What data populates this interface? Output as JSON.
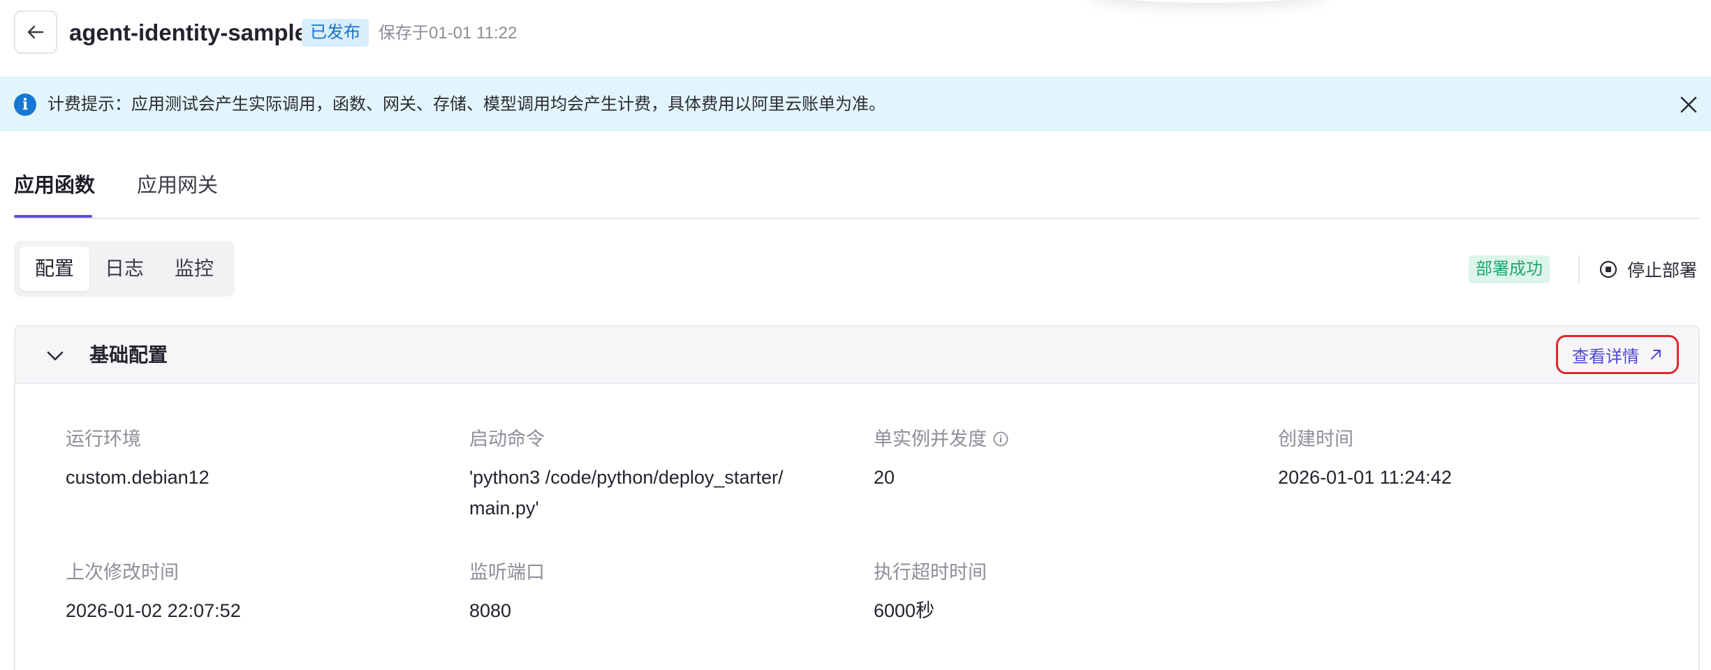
{
  "header": {
    "app_name": "agent-identity-sample",
    "status": "已发布",
    "saved_at": "保存于01-01 11:22"
  },
  "notice": {
    "text": "计费提示：应用测试会产生实际调用，函数、网关、存储、模型调用均会产生计费，具体费用以阿里云账单为准。"
  },
  "main_tabs": [
    {
      "label": "应用函数",
      "active": true
    },
    {
      "label": "应用网关",
      "active": false
    }
  ],
  "sub_tabs": [
    {
      "label": "配置",
      "active": true
    },
    {
      "label": "日志",
      "active": false
    },
    {
      "label": "监控",
      "active": false
    }
  ],
  "deploy": {
    "status": "部署成功",
    "stop_label": "停止部署"
  },
  "config_panel": {
    "title": "基础配置",
    "detail_link": "查看详情",
    "fields": [
      {
        "label": "运行环境",
        "value": "custom.debian12"
      },
      {
        "label": "启动命令",
        "value": "'python3 /code/python/deploy_starter/main.py'"
      },
      {
        "label": "单实例并发度",
        "value": "20"
      },
      {
        "label": "创建时间",
        "value": "2026-01-01 11:24:42"
      },
      {
        "label": "上次修改时间",
        "value": "2026-01-02 22:07:52"
      },
      {
        "label": "监听端口",
        "value": "8080"
      },
      {
        "label": "执行超时时间",
        "value": "6000秒"
      }
    ]
  },
  "colors": {
    "accent": "#5b4fd8",
    "link": "#4f46d6",
    "success": "#1ea672",
    "info": "#1777d2",
    "highlight_border": "#e0262a"
  },
  "icons": [
    "back-arrow-icon",
    "info-icon",
    "close-icon",
    "stop-circle-icon",
    "chevron-down-icon",
    "external-link-icon",
    "info-outline-icon"
  ]
}
